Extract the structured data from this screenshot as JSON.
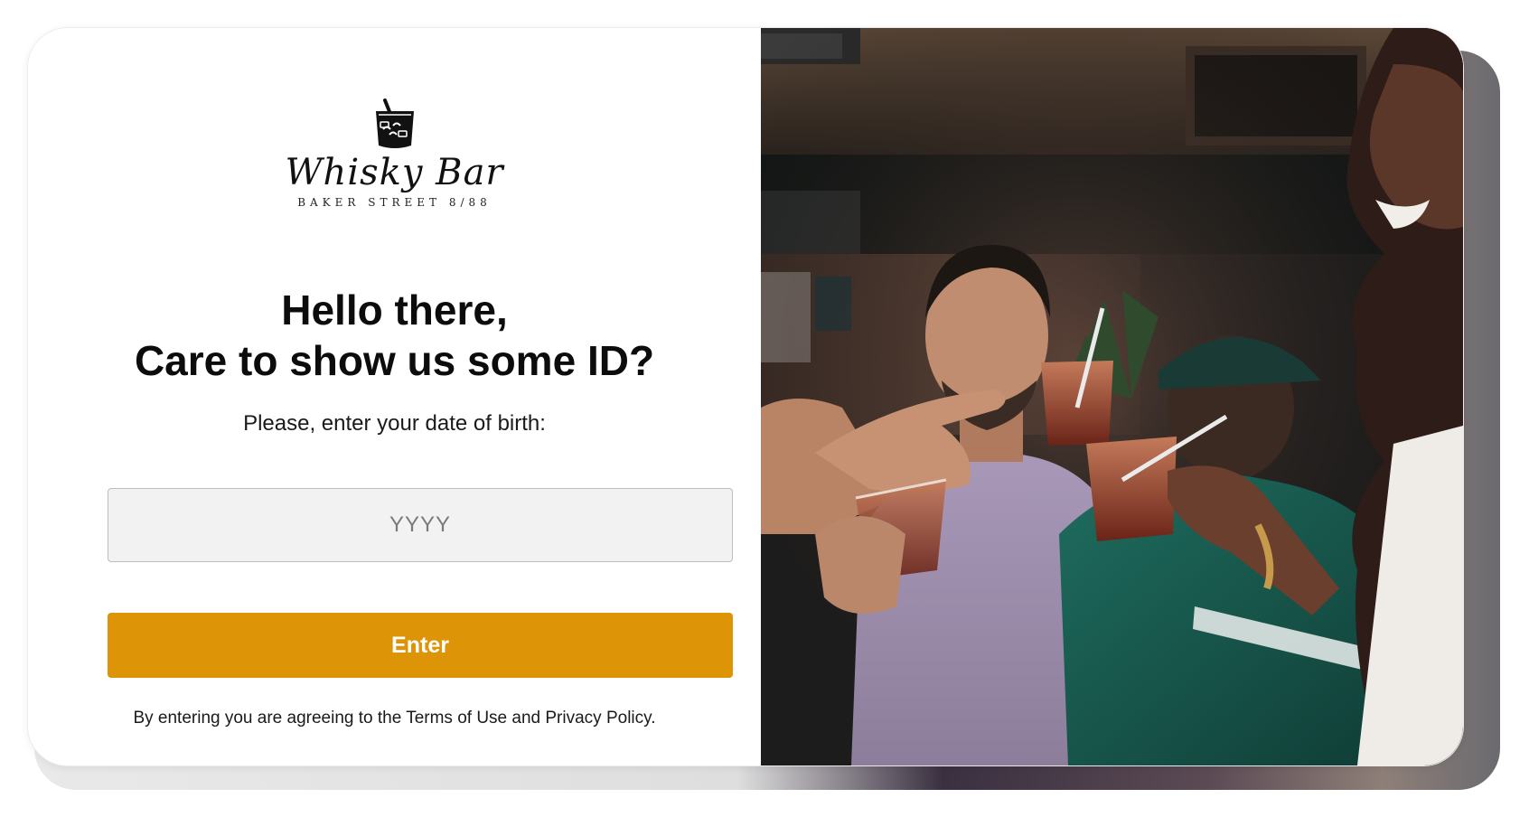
{
  "brand": {
    "name": "Whisky Bar",
    "subtitle": "BAKER STREET 8/88",
    "logo_icon": "whisky-glass-icon"
  },
  "gate": {
    "heading_line1": "Hello there,",
    "heading_line2": "Care to show us some ID?",
    "prompt": "Please, enter your date of birth:",
    "dob_placeholder": "YYYY",
    "dob_value": "",
    "enter_label": "Enter",
    "terms": "By entering you are agreeing to the Terms of Use and Privacy Policy."
  },
  "colors": {
    "accent": "#de9407",
    "input_bg": "#f2f2f2",
    "text": "#0c0c0c"
  },
  "photo": {
    "subject": "bar-patrons-toasting-photo"
  }
}
